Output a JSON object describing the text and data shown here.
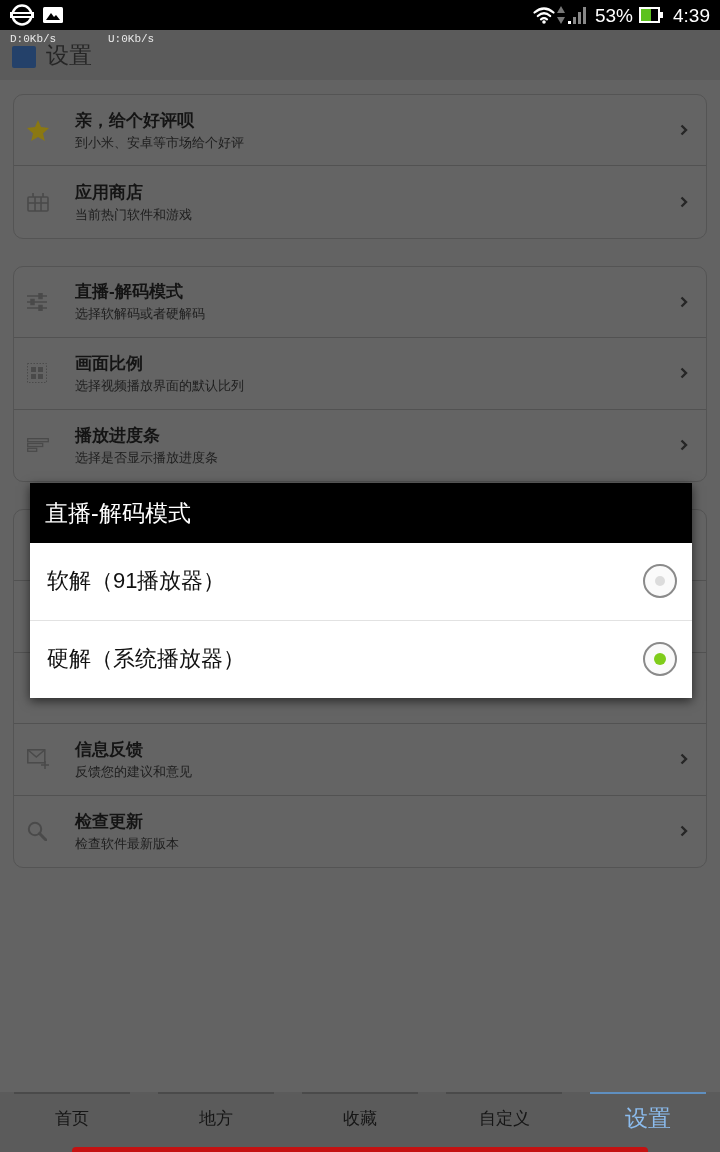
{
  "status_bar": {
    "battery": "53%",
    "time": "4:39"
  },
  "speed_overlay": {
    "download": "D:0Kb/s",
    "upload": "U:0Kb/s"
  },
  "header": {
    "title": "设置"
  },
  "cards": [
    {
      "kind": "plain",
      "items": [
        {
          "kind": "star",
          "title": "亲，给个好评呗",
          "subtitle": "到小米、安卓等市场给个好评"
        },
        {
          "kind": "store",
          "title": "应用商店",
          "subtitle": "当前热门软件和游戏"
        }
      ]
    },
    {
      "kind": "plain",
      "items": [
        {
          "kind": "sliders",
          "title": "直播-解码模式",
          "subtitle": "选择软解码或者硬解码"
        },
        {
          "kind": "grid",
          "title": "画面比例",
          "subtitle": "选择视频播放界面的默认比列"
        },
        {
          "kind": "bars",
          "title": "播放进度条",
          "subtitle": "选择是否显示播放进度条"
        }
      ]
    },
    {
      "kind": "covered",
      "items": [
        {
          "kind": "mail",
          "title": "信息反馈",
          "subtitle": "反馈您的建议和意见"
        },
        {
          "kind": "search",
          "title": "检查更新",
          "subtitle": "检查软件最新版本"
        }
      ]
    }
  ],
  "dialog": {
    "title": "直播-解码模式",
    "options": [
      {
        "label": "软解（91播放器）",
        "selected": false
      },
      {
        "label": "硬解（系统播放器）",
        "selected": true
      }
    ]
  },
  "tabs": [
    {
      "label": "首页",
      "selected": false
    },
    {
      "label": "地方",
      "selected": false
    },
    {
      "label": "收藏",
      "selected": false
    },
    {
      "label": "自定义",
      "selected": false
    },
    {
      "label": "设置",
      "selected": true
    }
  ]
}
